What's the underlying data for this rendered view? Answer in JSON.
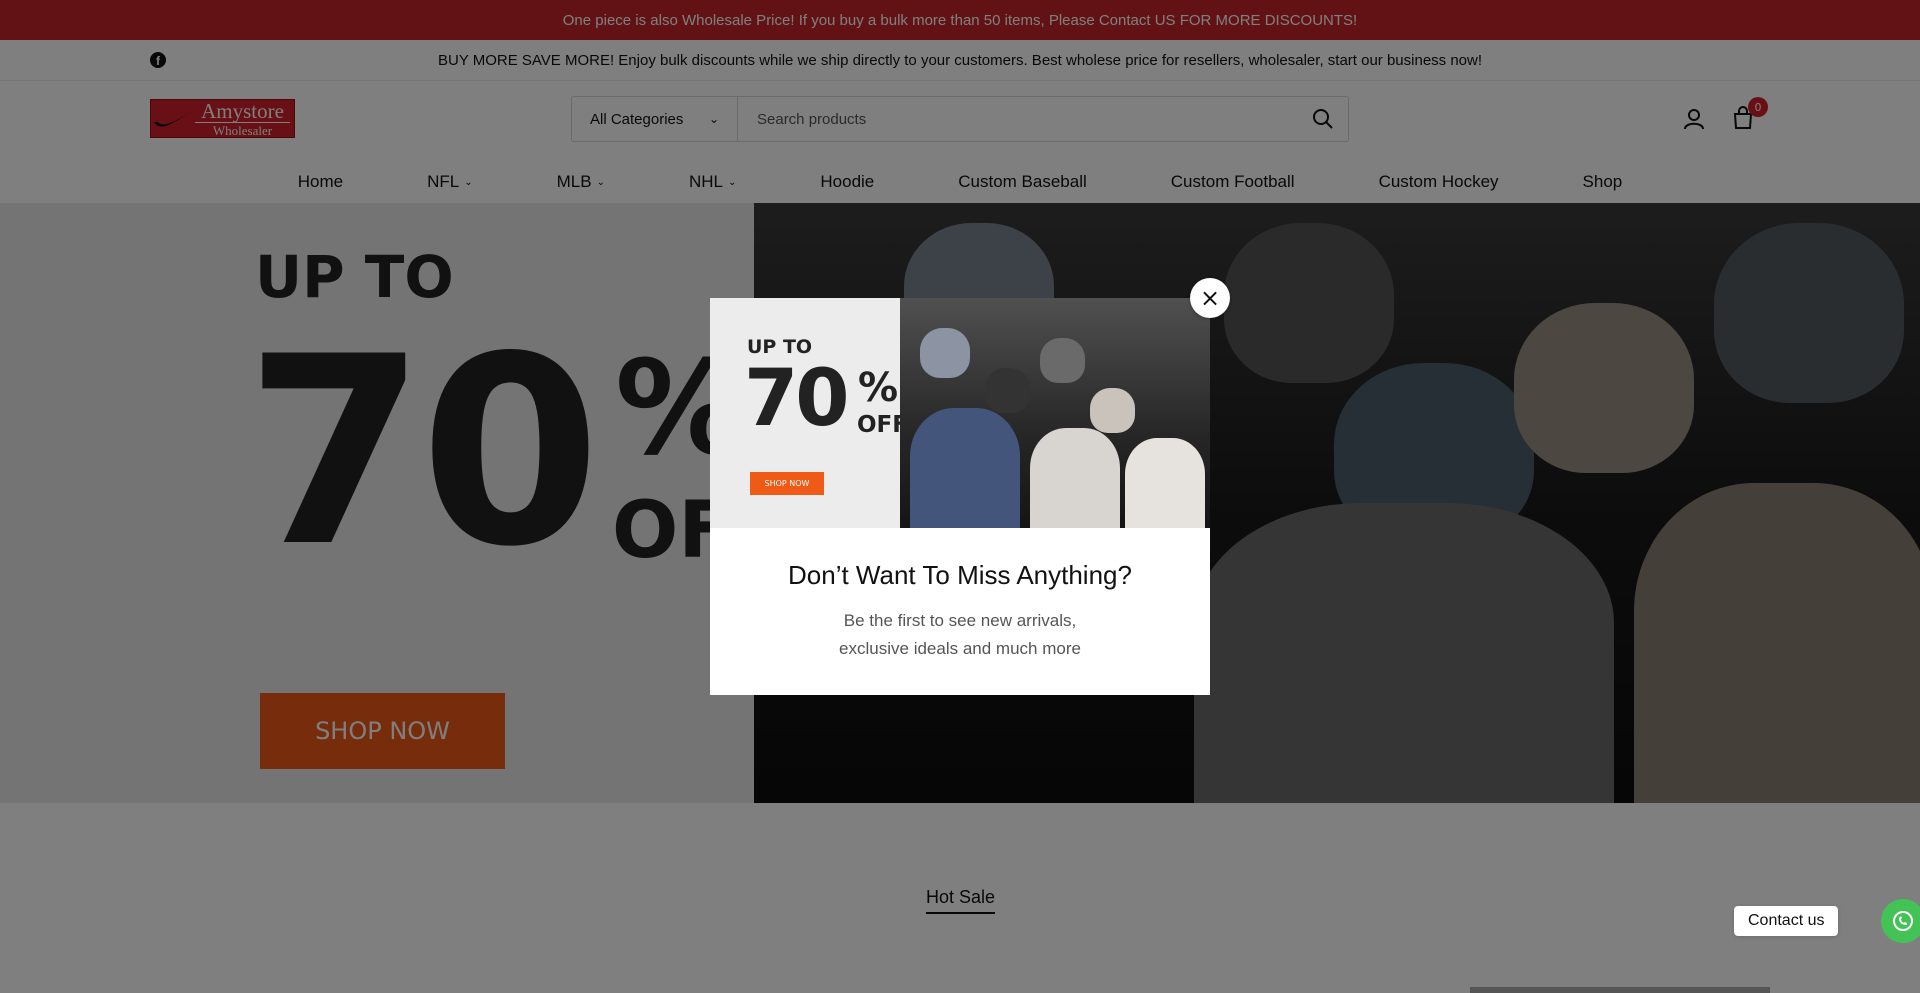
{
  "announcement": {
    "text": "One piece is also Wholesale Price! If you buy a bulk more than 50 items, Please Contact US FOR MORE DISCOUNTS!"
  },
  "topbar": {
    "message": "BUY MORE SAVE MORE! Enjoy bulk discounts while we ship directly to your customers. Best wholese price for resellers, wholesaler, start our business now!",
    "social_icon": "facebook-icon"
  },
  "header": {
    "logo": {
      "line1": "Amystore",
      "line2": "Wholesaler"
    },
    "search": {
      "category": "All Categories",
      "placeholder": "Search products"
    },
    "cart_count": "0"
  },
  "nav": {
    "items": [
      {
        "label": "Home",
        "dropdown": false
      },
      {
        "label": "NFL",
        "dropdown": true
      },
      {
        "label": "MLB",
        "dropdown": true
      },
      {
        "label": "NHL",
        "dropdown": true
      },
      {
        "label": "Hoodie",
        "dropdown": false
      },
      {
        "label": "Custom Baseball",
        "dropdown": false
      },
      {
        "label": "Custom Football",
        "dropdown": false
      },
      {
        "label": "Custom Hockey",
        "dropdown": false
      },
      {
        "label": "Shop",
        "dropdown": false
      }
    ]
  },
  "hero": {
    "up_to": "UP TO",
    "number": "70",
    "percent": "%",
    "off": "OFF",
    "cta": "SHOP NOW"
  },
  "modal": {
    "banner": {
      "up_to": "UP TO",
      "number": "70",
      "percent": "%",
      "off": "OFF",
      "cta": "SHOP NOW"
    },
    "title": "Don’t Want To Miss Anything?",
    "subtitle": "Be the first to see new arrivals, exclusive ideals and much more",
    "close_icon": "close-icon"
  },
  "section": {
    "title": "Hot Sale"
  },
  "contact": {
    "label": "Contact us",
    "icon": "whatsapp-icon"
  },
  "colors": {
    "accent": "#c4252b",
    "cta": "#ef5a16",
    "whatsapp": "#43c356"
  }
}
